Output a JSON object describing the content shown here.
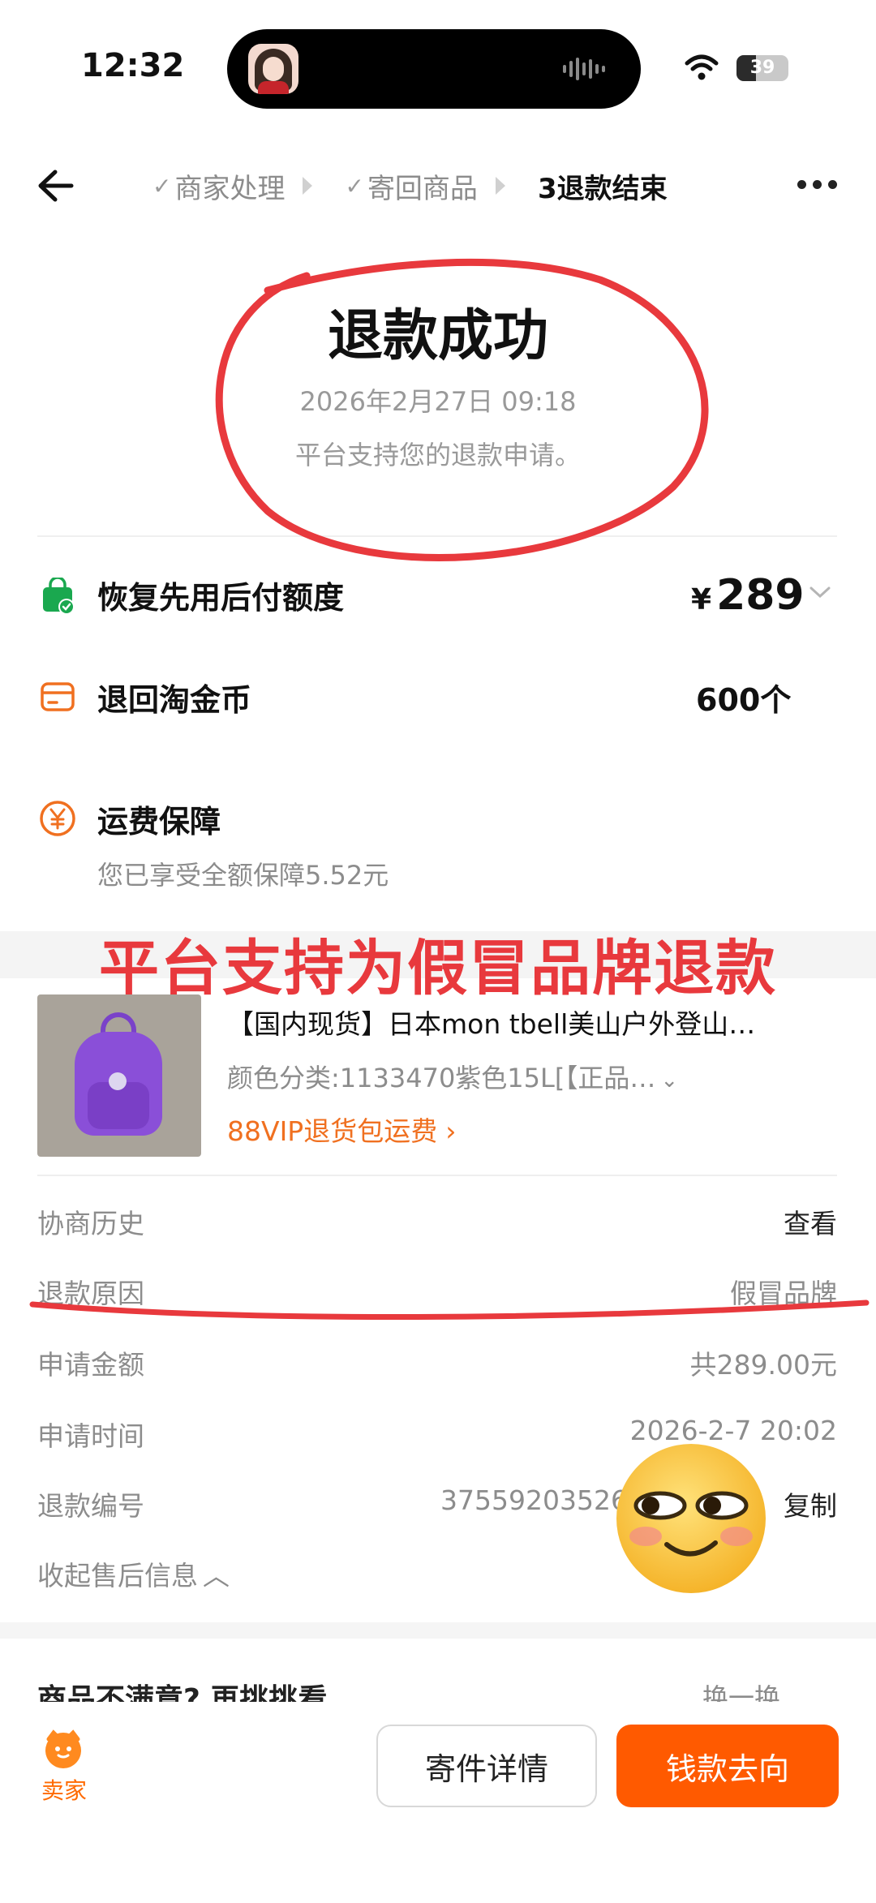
{
  "status_bar": {
    "time": "12:32",
    "battery": "39"
  },
  "nav": {
    "steps": [
      {
        "label": "商家处理",
        "prefix": "✓"
      },
      {
        "label": "寄回商品",
        "prefix": "✓"
      },
      {
        "label": "3退款结束",
        "prefix": ""
      }
    ]
  },
  "result": {
    "title": "退款成功",
    "time": "2026年2月27日 09:18",
    "desc": "平台支持您的退款申请。"
  },
  "refund_items": [
    {
      "icon": "shopping-bag-check-icon",
      "label": "恢复先用后付额度",
      "currency": "¥",
      "amount": "289"
    },
    {
      "icon": "coin-card-icon",
      "label": "退回淘金币",
      "value": "600个"
    },
    {
      "icon": "yen-circle-icon",
      "label": "运费保障",
      "sub": "您已享受全额保障5.52元"
    }
  ],
  "overlay_banner": "平台支持为假冒品牌退款",
  "product": {
    "title": "【国内现货】日本mon tbell美山户外登山…",
    "spec": "颜色分类:1133470紫色15L[【正品…",
    "promo": "88VIP退货包运费"
  },
  "info": {
    "history_label": "协商历史",
    "history_value": "查看",
    "reason_label": "退款原因",
    "reason_value": "假冒品牌",
    "amount_label": "申请金额",
    "amount_value": "共289.00元",
    "time_label": "申请时间",
    "time_value": "2026-2-7 20:02",
    "id_label": "退款编号",
    "id_value": "37559203526",
    "copy_label": "复制",
    "collapse_label": "收起售后信息"
  },
  "next": {
    "title": "商品不满意? 再挑挑看",
    "right": "换一换"
  },
  "bottom": {
    "seller_label": "卖家",
    "shipping_button": "寄件详情",
    "money_button": "钱款去向"
  },
  "colors": {
    "accent": "#ff5a00",
    "annotation_red": "#e8393d",
    "promo_orange": "#f07020"
  }
}
